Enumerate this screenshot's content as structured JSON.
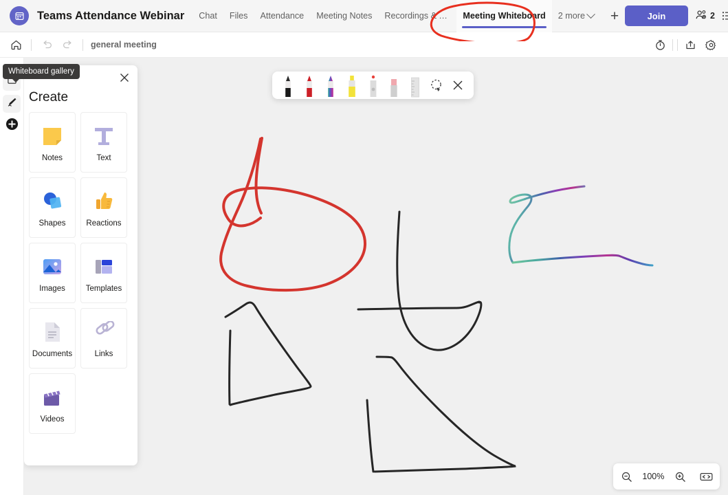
{
  "header": {
    "logo_icon": "teams-meeting-icon",
    "meeting_title": "Teams Attendance Webinar",
    "tabs": [
      {
        "label": "Chat",
        "active": false
      },
      {
        "label": "Files",
        "active": false
      },
      {
        "label": "Attendance",
        "active": false
      },
      {
        "label": "Meeting Notes",
        "active": false
      },
      {
        "label": "Recordings & Transcr..",
        "active": false
      },
      {
        "label": "Meeting Whiteboard",
        "active": true
      }
    ],
    "more_tabs_label": "2 more",
    "add_tab_label": "+",
    "join_label": "Join",
    "participants_count": "2",
    "accent_color": "#5b5fc7",
    "annotation_color": "#e8301f"
  },
  "subbar": {
    "home_icon": "home-icon",
    "undo_icon": "undo-icon",
    "redo_icon": "redo-icon",
    "board_name": "general meeting",
    "timer_icon": "timer-icon",
    "share_icon": "share-icon",
    "settings_icon": "gear-icon"
  },
  "left_rail": {
    "tooltip": "Whiteboard gallery",
    "items": [
      {
        "name": "whiteboard-gallery",
        "icon": "gallery-icon"
      },
      {
        "name": "inking",
        "icon": "pen-icon"
      },
      {
        "name": "create",
        "icon": "plus-circle-icon"
      }
    ]
  },
  "create_panel": {
    "title": "Create",
    "close_label": "×",
    "tiles": [
      {
        "label": "Notes",
        "icon": "sticky-note-icon"
      },
      {
        "label": "Text",
        "icon": "text-t-icon"
      },
      {
        "label": "Shapes",
        "icon": "shapes-icon"
      },
      {
        "label": "Reactions",
        "icon": "thumbs-up-icon"
      },
      {
        "label": "Images",
        "icon": "image-icon"
      },
      {
        "label": "Templates",
        "icon": "templates-icon"
      },
      {
        "label": "Documents",
        "icon": "document-icon"
      },
      {
        "label": "Links",
        "icon": "link-chain-icon"
      },
      {
        "label": "Videos",
        "icon": "video-clapperboard-icon"
      }
    ]
  },
  "pen_toolbar": {
    "tools": [
      {
        "name": "black-pen",
        "color": "#1a1a1a"
      },
      {
        "name": "red-pen",
        "color": "#cc2027"
      },
      {
        "name": "rainbow-pen",
        "color": "#7a3fb8"
      },
      {
        "name": "yellow-highlighter",
        "color": "#f2e23a"
      },
      {
        "name": "laser-pointer",
        "color": "#bdbdbd"
      },
      {
        "name": "eraser",
        "color": "#f0a8ae"
      },
      {
        "name": "ruler",
        "color": "#d9d9d9"
      },
      {
        "name": "lasso-select",
        "color": "#333333"
      },
      {
        "name": "close-inking",
        "color": "#333333"
      }
    ]
  },
  "zoom_controls": {
    "zoom_out_icon": "zoom-out-icon",
    "level": "100%",
    "zoom_in_icon": "zoom-in-icon",
    "fit_icon": "fit-to-screen-icon"
  },
  "canvas": {
    "background": "#f0f0f0",
    "strokes": [
      {
        "name": "red-loop-stroke",
        "color": "#d4352e",
        "width": 4
      },
      {
        "name": "black-arc-stroke",
        "color": "#262626",
        "width": 3
      },
      {
        "name": "black-horizontal-stroke",
        "color": "#262626",
        "width": 3
      },
      {
        "name": "black-triangle-left",
        "color": "#262626",
        "width": 3
      },
      {
        "name": "black-triangle-bottom",
        "color": "#262626",
        "width": 3
      },
      {
        "name": "rainbow-stroke",
        "color": "gradient",
        "width": 3
      }
    ]
  }
}
